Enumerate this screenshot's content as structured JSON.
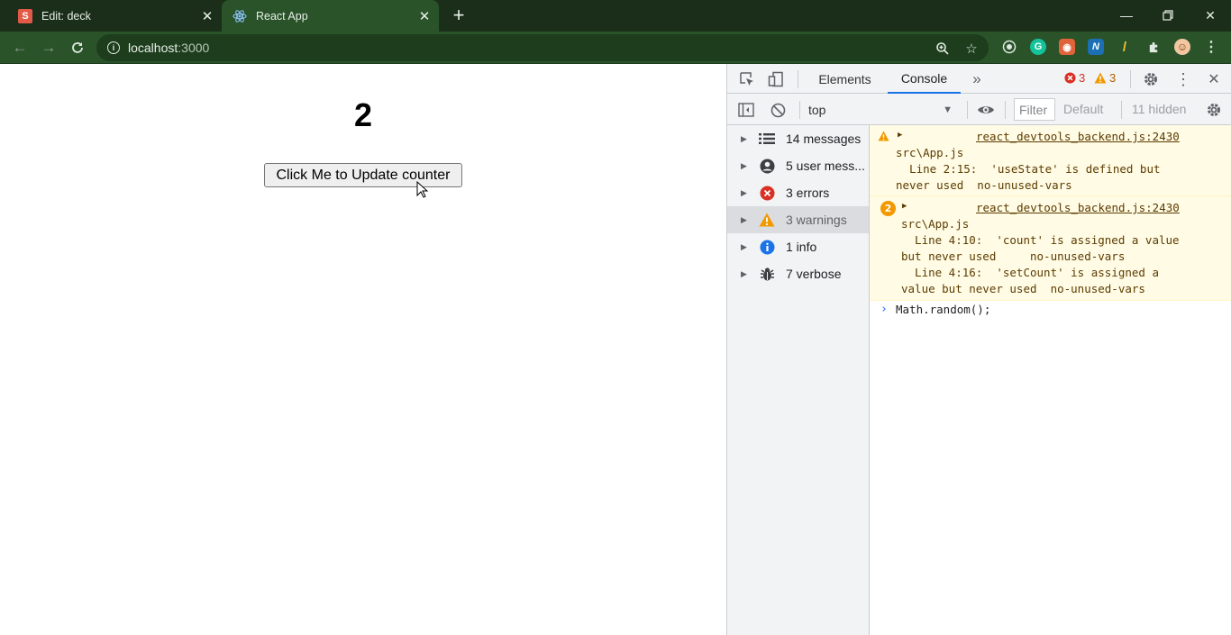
{
  "browser": {
    "tabs": [
      {
        "favicon": "S",
        "title": "Edit: deck"
      },
      {
        "favicon": "react-icon",
        "title": "React App"
      }
    ],
    "new_tab": "+",
    "url_host": "localhost",
    "url_port": ":3000"
  },
  "page": {
    "counter": "2",
    "button_label": "Click Me to Update counter"
  },
  "devtools": {
    "tabs": [
      "Elements",
      "Console"
    ],
    "more_tabs": "»",
    "error_count": "3",
    "warning_count": "3",
    "context": "top",
    "filter_placeholder": "Filter",
    "levels": "Default",
    "hidden": "11 hidden",
    "sidebar": [
      {
        "icon": "list-icon",
        "label": "14 messages"
      },
      {
        "icon": "user-icon",
        "label": "5 user mess..."
      },
      {
        "icon": "error-icon",
        "label": "3 errors"
      },
      {
        "icon": "warning-icon",
        "label": "3 warnings"
      },
      {
        "icon": "info-icon",
        "label": "1 info"
      },
      {
        "icon": "bug-icon",
        "label": "7 verbose"
      }
    ],
    "messages": [
      {
        "repeat": "",
        "source": "react_devtools_backend.js:2430",
        "lines": [
          "src\\App.js",
          "  Line 2:15:  'useState' is defined but",
          "never used  no-unused-vars"
        ]
      },
      {
        "repeat": "2",
        "source": "react_devtools_backend.js:2430",
        "lines": [
          "src\\App.js",
          "  Line 4:10:  'count' is assigned a value",
          "but never used     no-unused-vars",
          "  Line 4:16:  'setCount' is assigned a",
          "value but never used  no-unused-vars"
        ]
      }
    ],
    "prompt": "Math.random();"
  }
}
